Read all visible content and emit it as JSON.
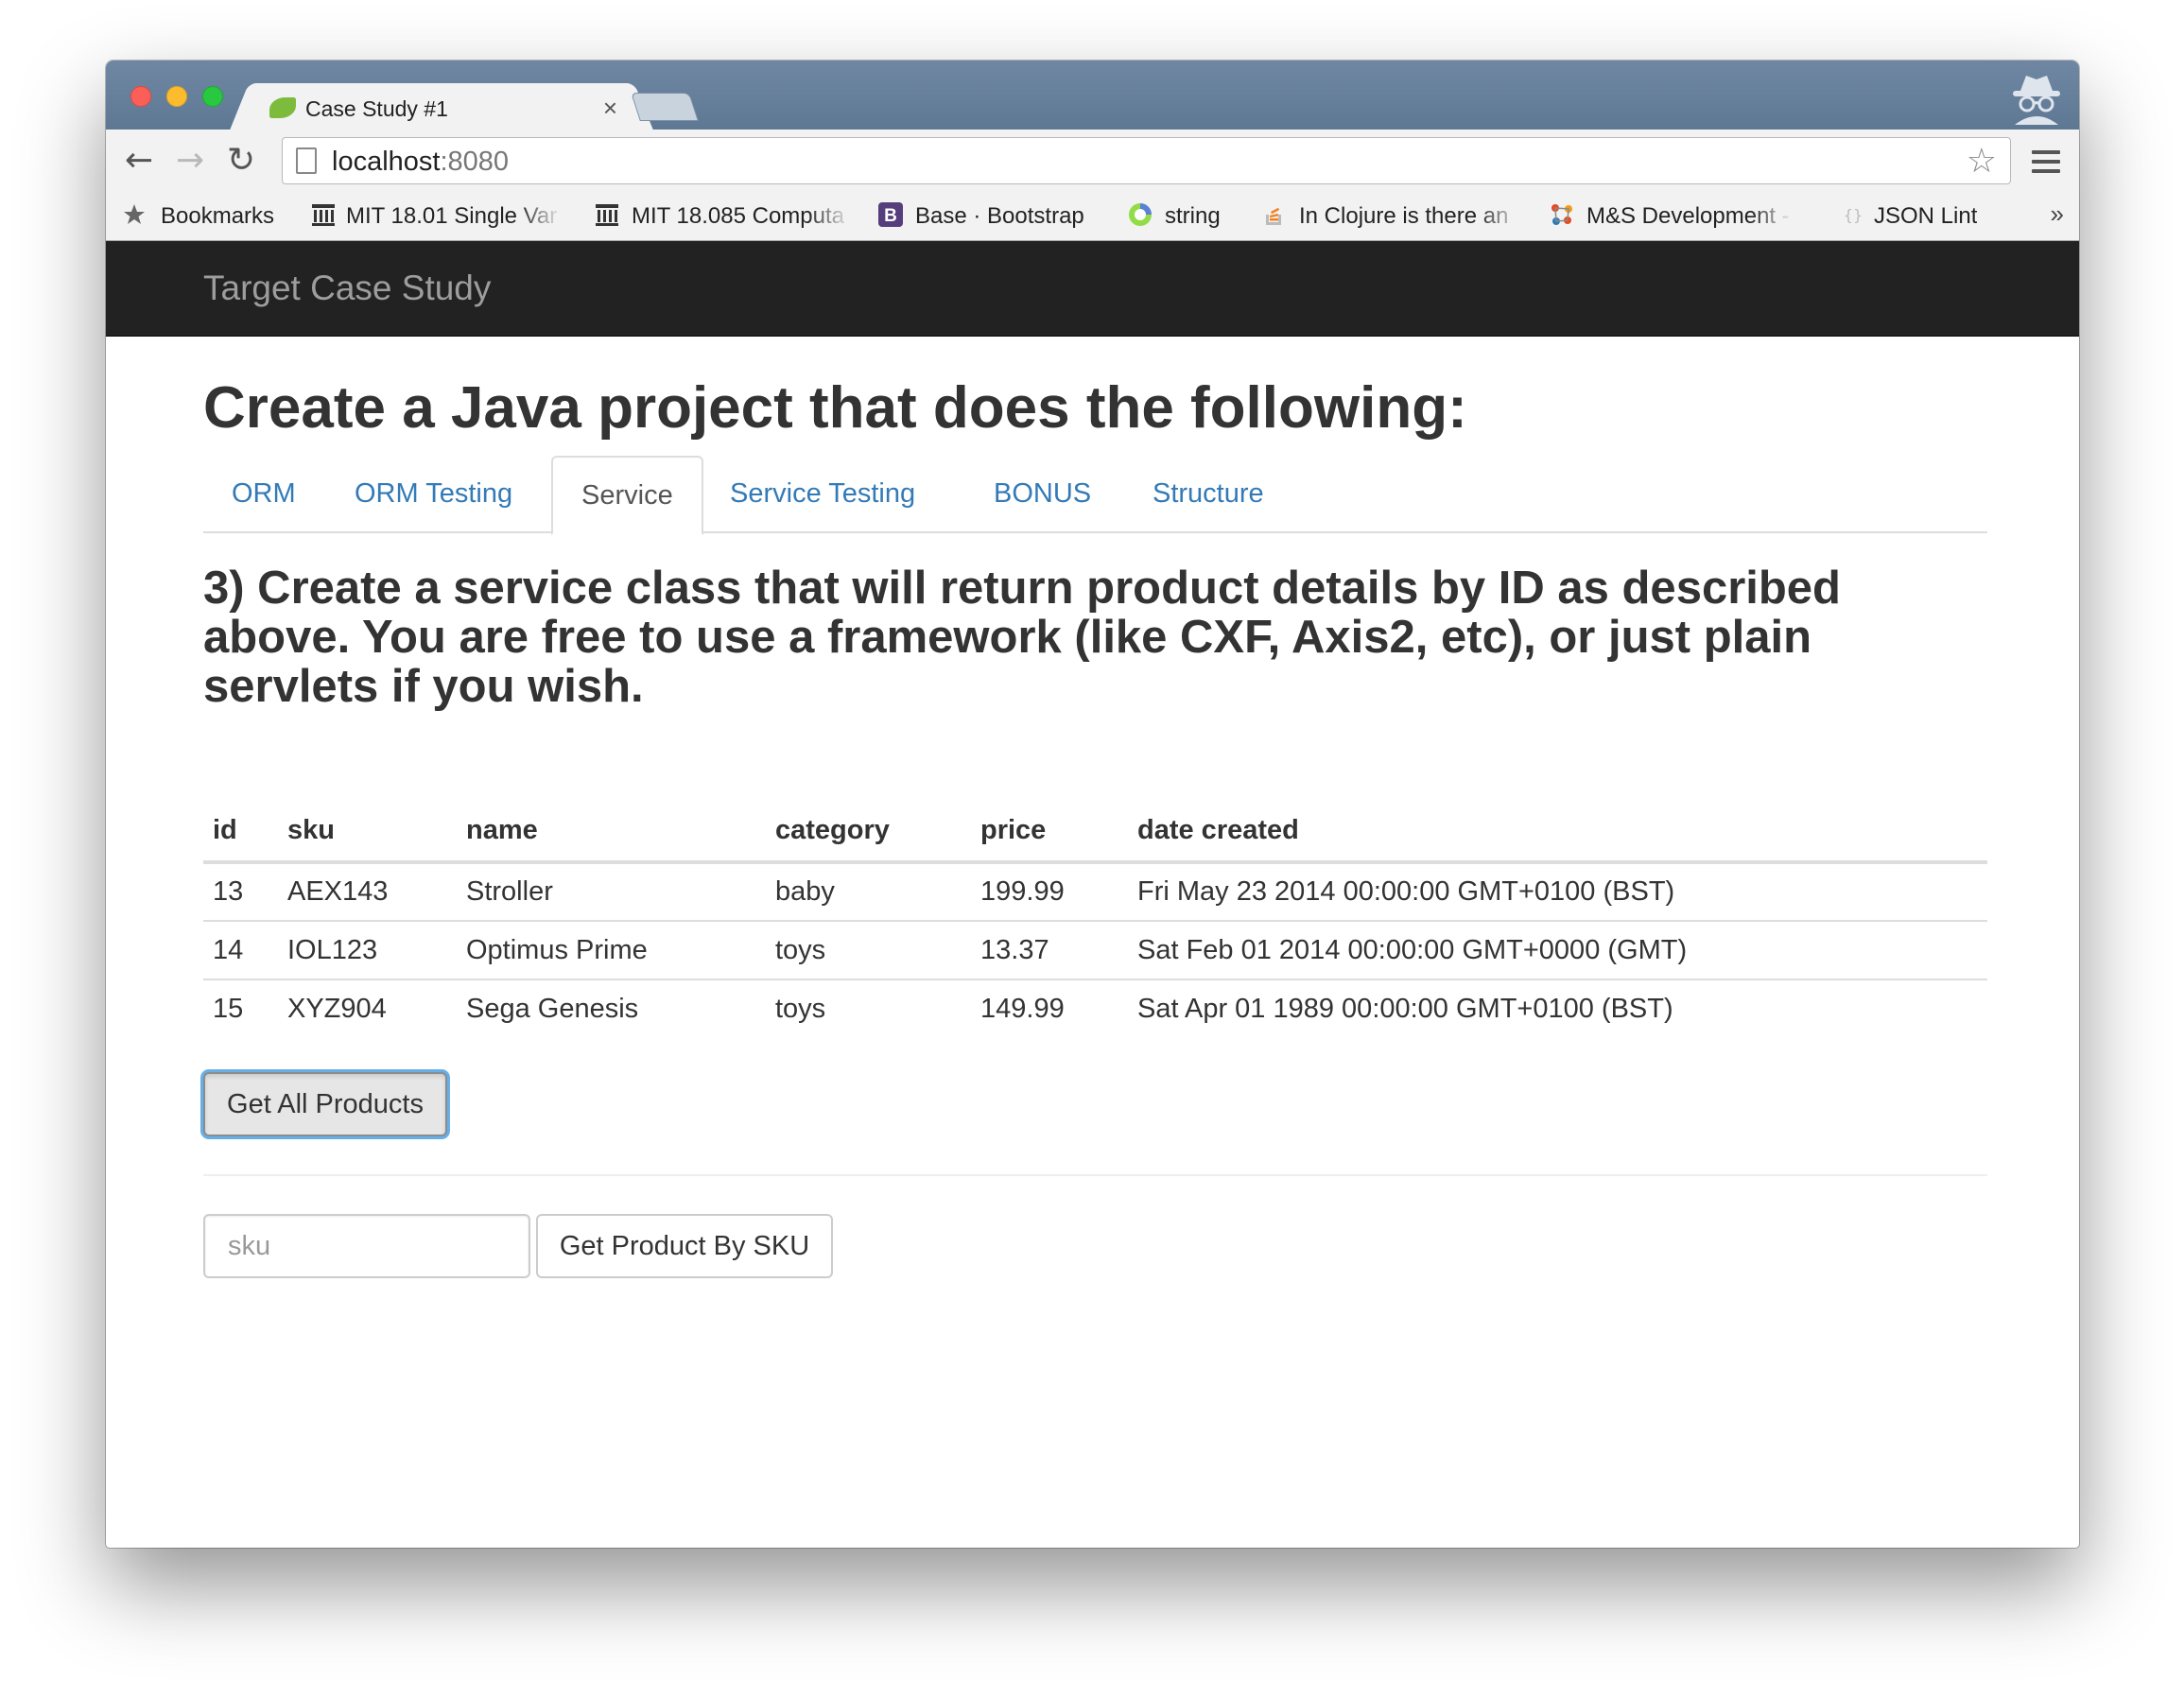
{
  "browser": {
    "tab_title": "Case Study #1",
    "tab_close": "×",
    "url_host": "localhost",
    "url_port": ":8080",
    "bookmarks": [
      {
        "label": "Bookmarks",
        "icon": "star-icon"
      },
      {
        "label": "MIT 18.01 Single Var",
        "icon": "mit-icon"
      },
      {
        "label": "MIT 18.085 Computa",
        "icon": "mit-icon"
      },
      {
        "label": "Base · Bootstrap",
        "icon": "bootstrap-icon"
      },
      {
        "label": "string",
        "icon": "clojure-icon"
      },
      {
        "label": "In Clojure is there an",
        "icon": "stackoverflow-icon"
      },
      {
        "label": "M&S Development -",
        "icon": "ms-icon"
      },
      {
        "label": "JSON Lint",
        "icon": "json-icon"
      }
    ],
    "overflow": "»"
  },
  "navbar": {
    "brand": "Target Case Study"
  },
  "page": {
    "title": "Create a Java project that does the following:",
    "tabs": [
      {
        "label": "ORM",
        "active": false
      },
      {
        "label": "ORM Testing",
        "active": false
      },
      {
        "label": "Service",
        "active": true
      },
      {
        "label": "Service Testing",
        "active": false
      },
      {
        "label": "BONUS",
        "active": false
      },
      {
        "label": "Structure",
        "active": false
      }
    ],
    "section_heading": "3) Create a service class that will return product details by ID as described above. You are free to use a framework (like CXF, Axis2, etc), or just plain servlets if you wish.",
    "table": {
      "columns": [
        "id",
        "sku",
        "name",
        "category",
        "price",
        "date created"
      ],
      "rows": [
        [
          "13",
          "AEX143",
          "Stroller",
          "baby",
          "199.99",
          "Fri May 23 2014 00:00:00 GMT+0100 (BST)"
        ],
        [
          "14",
          "IOL123",
          "Optimus Prime",
          "toys",
          "13.37",
          "Sat Feb 01 2014 00:00:00 GMT+0000 (GMT)"
        ],
        [
          "15",
          "XYZ904",
          "Sega Genesis",
          "toys",
          "149.99",
          "Sat Apr 01 1989 00:00:00 GMT+0100 (BST)"
        ]
      ]
    },
    "get_all_button": "Get All Products",
    "sku_placeholder": "sku",
    "sku_value": "",
    "get_by_sku_button": "Get Product By SKU"
  },
  "colors": {
    "navbar_bg": "#222222",
    "link": "#337ab7",
    "focus_ring": "#66afe9"
  }
}
